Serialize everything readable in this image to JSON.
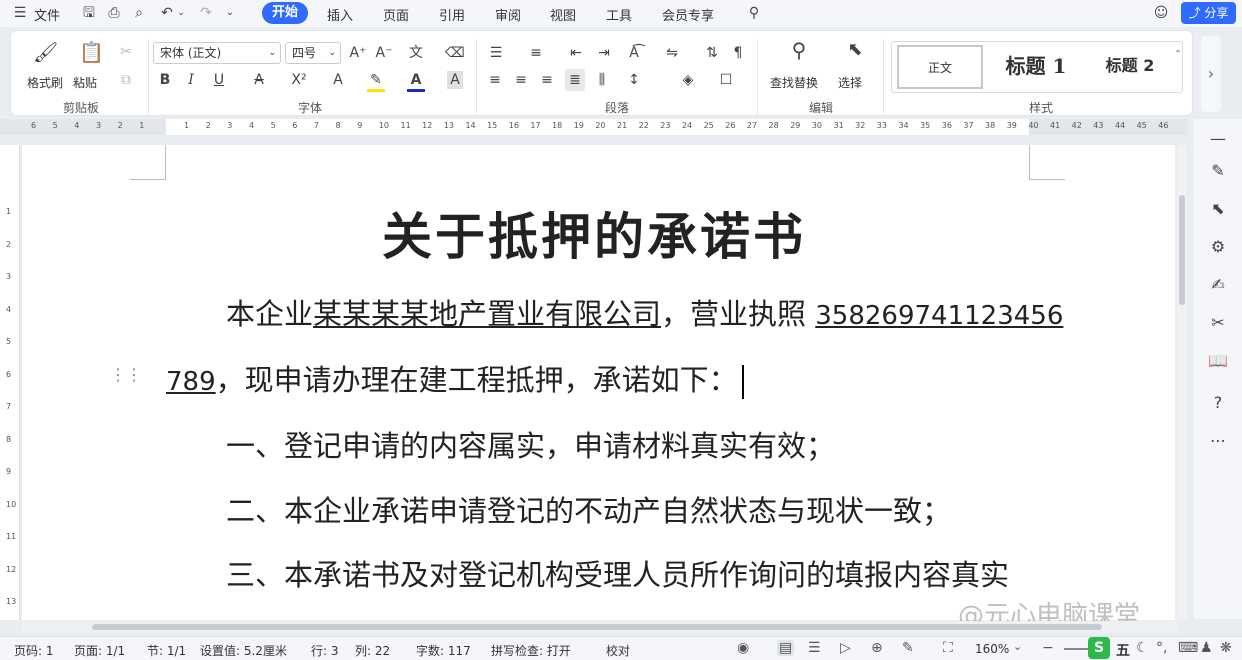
{
  "menubar": {
    "file": "文件",
    "tabs": [
      "开始",
      "插入",
      "页面",
      "引用",
      "审阅",
      "视图",
      "工具",
      "会员专享"
    ],
    "active_tab": "开始",
    "share": "分享"
  },
  "ribbon": {
    "clipboard": {
      "format_painter": "格式刷",
      "paste": "粘贴",
      "group": "剪贴板"
    },
    "font": {
      "family": "宋体 (正文)",
      "size": "四号",
      "group": "字体"
    },
    "paragraph": {
      "group": "段落"
    },
    "edit": {
      "find_replace": "查找替换",
      "select": "选择",
      "group": "编辑"
    },
    "styles": {
      "normal": "正文",
      "heading1": "标题  1",
      "heading2": "标题  2",
      "group": "样式"
    }
  },
  "ruler": {
    "left_marks": [
      "6",
      "5",
      "4",
      "3",
      "2",
      "1"
    ],
    "right_marks": [
      "1",
      "2",
      "3",
      "4",
      "5",
      "6",
      "7",
      "8",
      "9",
      "10",
      "11",
      "12",
      "13",
      "14",
      "15",
      "16",
      "17",
      "18",
      "19",
      "20",
      "21",
      "22",
      "23",
      "24",
      "25",
      "26",
      "27",
      "28",
      "29",
      "30",
      "31",
      "32",
      "33",
      "34",
      "35",
      "36",
      "37",
      "38",
      "39",
      "40",
      "41",
      "42",
      "43",
      "44",
      "45",
      "46"
    ],
    "vertical_marks": [
      "1",
      "2",
      "3",
      "4",
      "5",
      "6",
      "7",
      "8",
      "9",
      "10",
      "11",
      "12",
      "13"
    ]
  },
  "document": {
    "title": "关于抵押的承诺书",
    "p1_prefix": "本企业",
    "p1_company": "某某某某地产置业有限公司",
    "p1_mid": "，营业执照 ",
    "p1_license_a": "358269741123456",
    "p1_license_b": "789",
    "p1_rest": "，现申请办理在建工程抵押，承诺如下：",
    "item1": "一、登记申请的内容属实，申请材料真实有效；",
    "item2": "二、本企业承诺申请登记的不动产自然状态与现状一致；",
    "item3": "三、本承诺书及对登记机构受理人员所作询问的填报内容真实"
  },
  "watermark": "@元心电脑课堂",
  "status": {
    "page_num": "页码: 1",
    "pages": "页面: 1/1",
    "section": "节: 1/1",
    "setting": "设置值: 5.2厘米",
    "row": "行: 3",
    "col": "列: 22",
    "words": "字数: 117",
    "spell": "拼写检查: 打开",
    "proof": "校对",
    "zoom": "160%"
  },
  "colors": {
    "accent": "#2f6bff",
    "font_color": "#1a2ccf",
    "highlight": "#ffe600"
  }
}
